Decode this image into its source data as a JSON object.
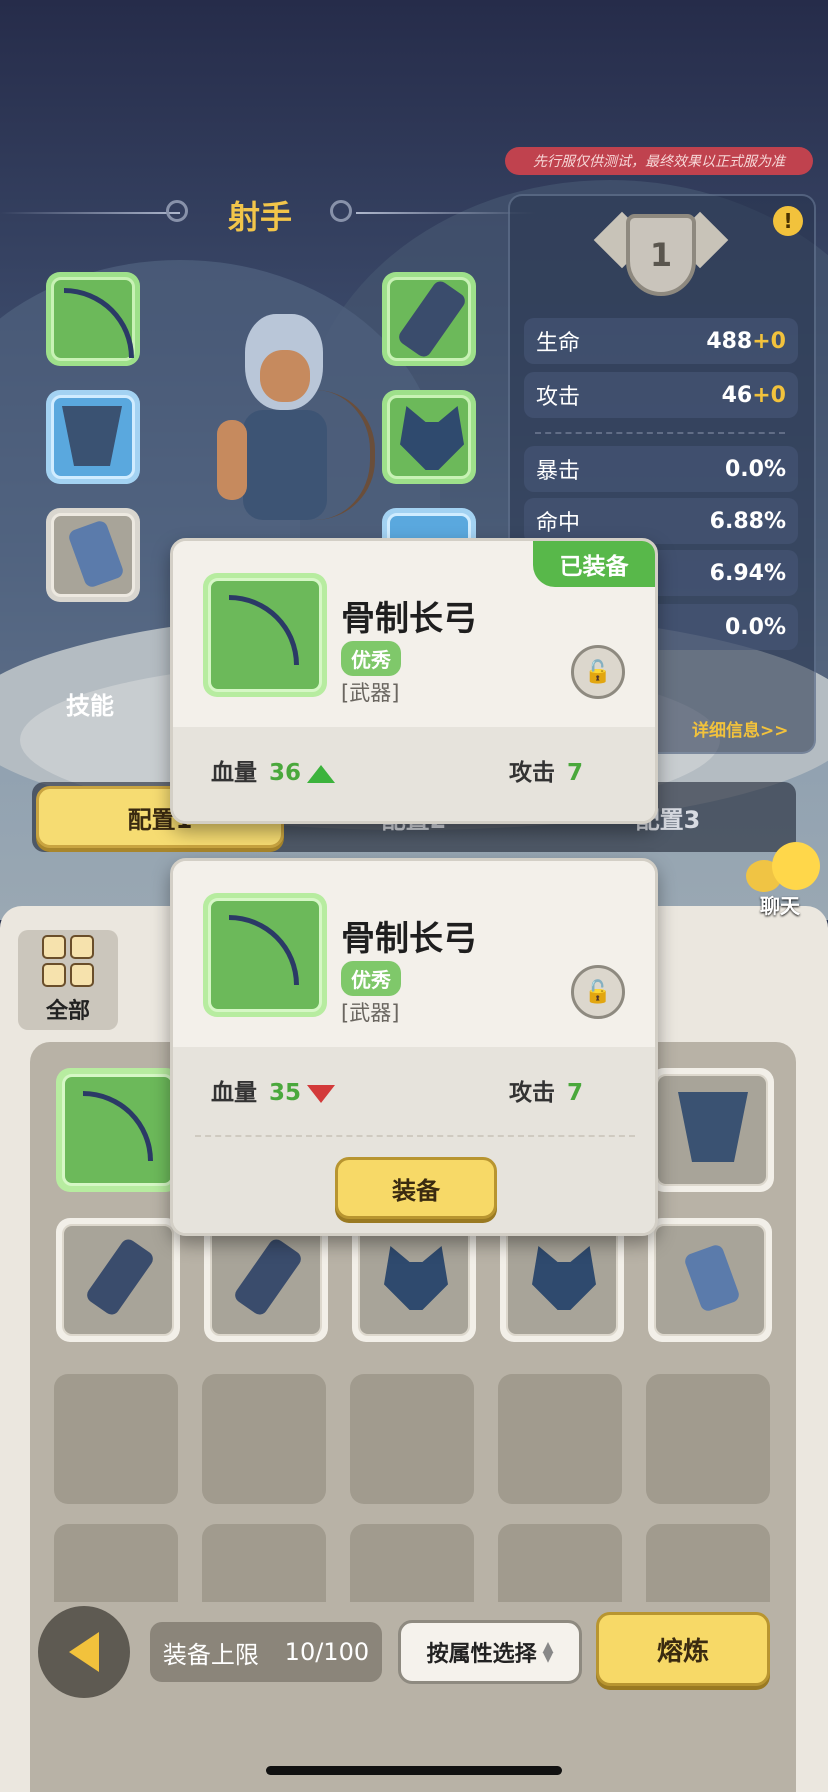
{
  "notice": "先行服仅供测试，最终效果以正式服为准",
  "hero": {
    "class_name": "射手"
  },
  "level": {
    "value": "1"
  },
  "stats": [
    {
      "label": "生命",
      "value": "488",
      "bonus": "+0"
    },
    {
      "label": "攻击",
      "value": "46",
      "bonus": "+0"
    },
    {
      "label": "暴击",
      "value": "0.0%"
    },
    {
      "label": "命中",
      "value": "6.88%"
    },
    {
      "label": "",
      "value": "6.94%"
    },
    {
      "label": "",
      "value": "0.0%"
    }
  ],
  "detail_link": "详细信息>>",
  "skill_label": "技能",
  "tabs": [
    "配置1",
    "配置2",
    "配置3"
  ],
  "chat_label": "聊天",
  "category_all": "全部",
  "equipped_card": {
    "name": "骨制长弓",
    "quality": "优秀",
    "slot_type": "[武器]",
    "equipped_badge": "已装备",
    "hp_label": "血量",
    "hp_value": "36",
    "atk_label": "攻击",
    "atk_value": "7"
  },
  "compare_card": {
    "name": "骨制长弓",
    "quality": "优秀",
    "slot_type": "[武器]",
    "hp_label": "血量",
    "hp_value": "35",
    "atk_label": "攻击",
    "atk_value": "7",
    "equip_button": "装备"
  },
  "capacity": {
    "label": "装备上限",
    "value": "10/100"
  },
  "sort_label": "按属性选择",
  "smelt_button": "熔炼",
  "colors": {
    "accent_gold": "#f2c23c",
    "quality_green": "#7fc86a",
    "stat_up": "#3cb33c",
    "stat_down": "#d33a3a"
  }
}
